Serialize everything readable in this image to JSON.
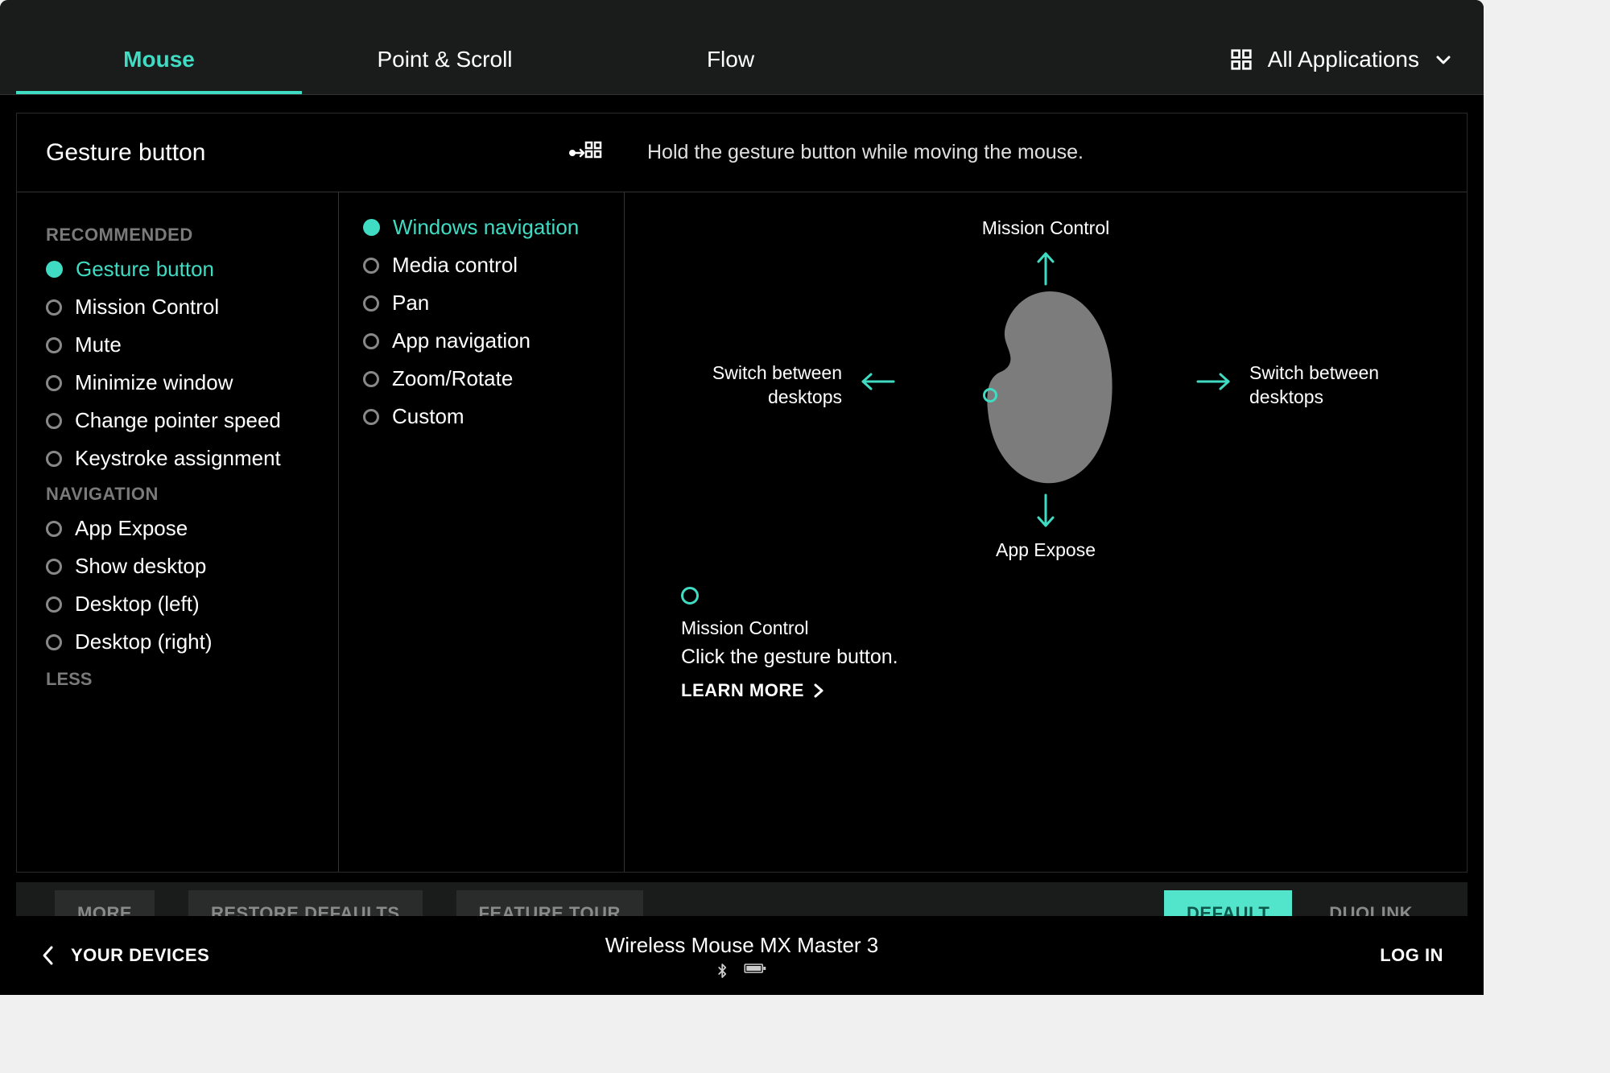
{
  "colors": {
    "accent": "#40dbc3"
  },
  "tabs": {
    "items": [
      {
        "label": "Mouse",
        "active": true
      },
      {
        "label": "Point & Scroll",
        "active": false
      },
      {
        "label": "Flow",
        "active": false
      }
    ],
    "app_switcher": "All Applications"
  },
  "panel": {
    "title": "Gesture button",
    "subtitle": "Hold the gesture button while moving the mouse."
  },
  "recommended_label": "RECOMMENDED",
  "navigation_label": "NAVIGATION",
  "less_label": "LESS",
  "col1": {
    "recommended": [
      "Gesture button",
      "Mission Control",
      "Mute",
      "Minimize window",
      "Change pointer speed",
      "Keystroke assignment"
    ],
    "navigation": [
      "App Expose",
      "Show desktop",
      "Desktop (left)",
      "Desktop (right)"
    ],
    "selected_index": 0
  },
  "col2": {
    "options": [
      "Windows navigation",
      "Media control",
      "Pan",
      "App navigation",
      "Zoom/Rotate",
      "Custom"
    ],
    "selected_index": 0
  },
  "diagram": {
    "up": "Mission Control",
    "down": "App Expose",
    "left": "Switch between desktops",
    "right": "Switch between desktops"
  },
  "click_info": {
    "label": "Mission Control",
    "desc": "Click the gesture button.",
    "learn_more": "LEARN MORE"
  },
  "bottom_buttons": {
    "more": "MORE",
    "restore": "RESTORE DEFAULTS",
    "tour": "FEATURE TOUR",
    "default": "DEFAULT",
    "duolink": "DUOLINK"
  },
  "footer": {
    "back": "YOUR DEVICES",
    "device_name": "Wireless Mouse MX Master 3",
    "login": "LOG IN"
  }
}
